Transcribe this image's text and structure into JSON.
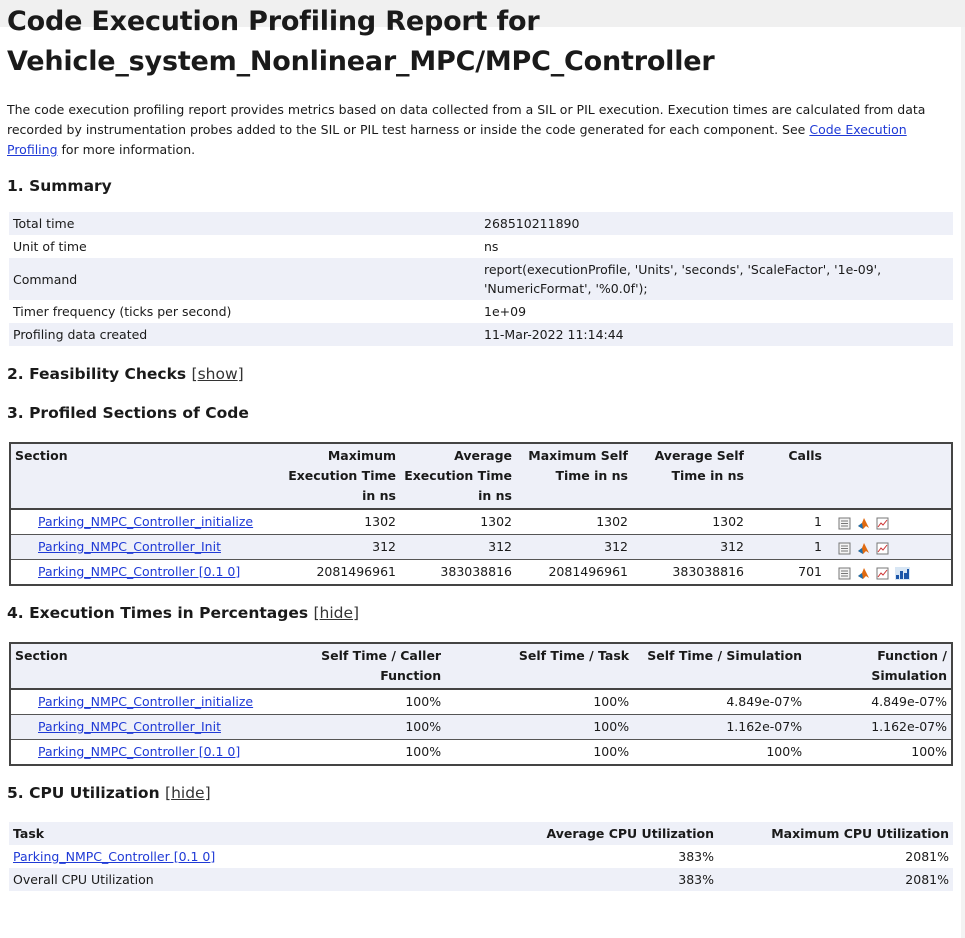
{
  "report": {
    "title": "Code Execution Profiling Report for Vehicle_system_Nonlinear_MPC/MPC_Controller",
    "intro_text": "The code execution profiling report provides metrics based on data collected from a SIL or PIL execution. Execution times are calculated from data recorded by instrumentation probes added to the SIL or PIL test harness or inside the code generated for each component. See ",
    "intro_link": "Code Execution Profiling",
    "intro_tail": " for more information."
  },
  "summary": {
    "heading": "1. Summary",
    "rows": [
      {
        "label": "Total time",
        "value": "268510211890"
      },
      {
        "label": "Unit of time",
        "value": "ns"
      },
      {
        "label": "Command",
        "value": "report(executionProfile, 'Units', 'seconds', 'ScaleFactor', '1e-09', 'NumericFormat', '%0.0f');"
      },
      {
        "label": "Timer frequency (ticks per second)",
        "value": "1e+09"
      },
      {
        "label": "Profiling data created",
        "value": "11-Mar-2022 11:14:44"
      }
    ]
  },
  "feasibility": {
    "heading": "2. Feasibility Checks",
    "toggle": "[show]"
  },
  "profiled": {
    "heading": "3. Profiled Sections of Code",
    "columns": [
      "Section",
      "Maximum Execution Time in ns",
      "Average Execution Time in ns",
      "Maximum Self Time in ns",
      "Average Self Time in ns",
      "Calls"
    ],
    "rows": [
      {
        "section": "Parking_NMPC_Controller_initialize",
        "max_exec": "1302",
        "avg_exec": "1302",
        "max_self": "1302",
        "avg_self": "1302",
        "calls": "1"
      },
      {
        "section": "Parking_NMPC_Controller_Init",
        "max_exec": "312",
        "avg_exec": "312",
        "max_self": "312",
        "avg_self": "312",
        "calls": "1"
      },
      {
        "section": "Parking_NMPC_Controller [0.1 0]",
        "max_exec": "2081496961",
        "avg_exec": "383038816",
        "max_self": "2081496961",
        "avg_self": "383038816",
        "calls": "701"
      }
    ],
    "icons": [
      "report-icon",
      "matlab-icon",
      "plot-icon",
      "histogram-icon"
    ]
  },
  "percentages": {
    "heading": "4. Execution Times in Percentages",
    "toggle": "[hide]",
    "columns": [
      "Section",
      "Self Time / Caller Function",
      "Self Time / Task",
      "Self Time / Simulation",
      "Function / Simulation"
    ],
    "rows": [
      {
        "section": "Parking_NMPC_Controller_initialize",
        "caller": "100%",
        "task": "100%",
        "sim": "4.849e-07%",
        "func": "4.849e-07%"
      },
      {
        "section": "Parking_NMPC_Controller_Init",
        "caller": "100%",
        "task": "100%",
        "sim": "1.162e-07%",
        "func": "1.162e-07%"
      },
      {
        "section": "Parking_NMPC_Controller [0.1 0]",
        "caller": "100%",
        "task": "100%",
        "sim": "100%",
        "func": "100%"
      }
    ]
  },
  "cpu": {
    "heading": "5. CPU Utilization",
    "toggle": "[hide]",
    "columns": [
      "Task",
      "Average CPU Utilization",
      "Maximum CPU Utilization"
    ],
    "rows": [
      {
        "task": "Parking_NMPC_Controller [0.1 0]",
        "avg": "383%",
        "max": "2081%"
      },
      {
        "task": "Overall CPU Utilization",
        "avg": "383%",
        "max": "2081%"
      }
    ]
  },
  "colors": {
    "link": "#1f3ad6",
    "row_shade": "#eef0f8",
    "border": "#444444"
  }
}
